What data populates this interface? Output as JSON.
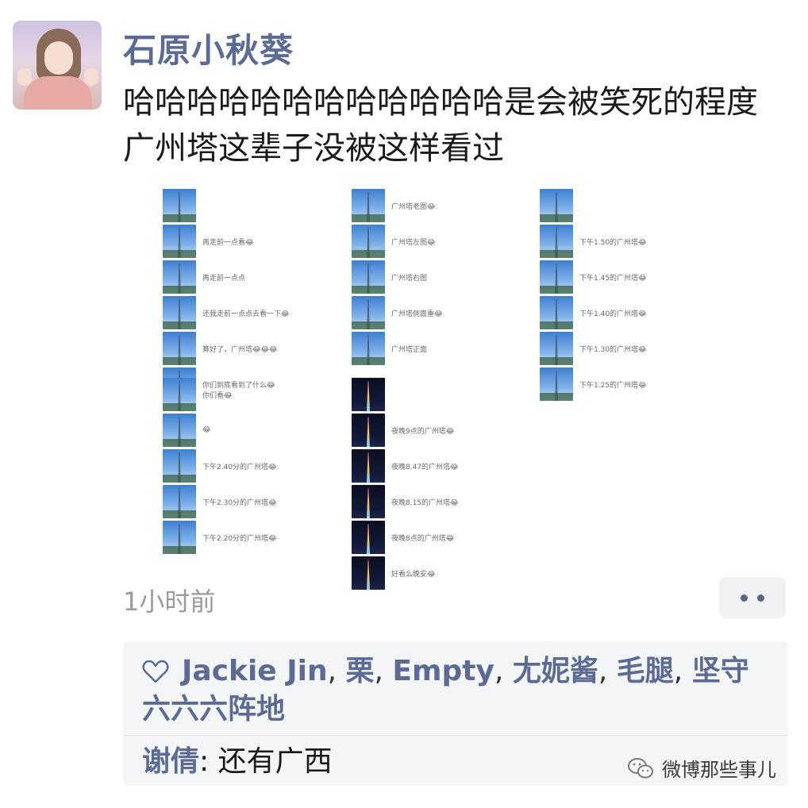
{
  "post": {
    "author": "石原小秋葵",
    "text": "哈哈哈哈哈哈哈哈哈哈哈哈是会被笑死的程度 广州塔这辈子没被这样看过",
    "time": "1小时前"
  },
  "thumbnail_groups": [
    {
      "group": "col1-top",
      "items": [
        {
          "caption": "",
          "theme": "day"
        },
        {
          "caption": "再走前一点看😂",
          "theme": "day"
        },
        {
          "caption": "再走前一点点",
          "theme": "day"
        },
        {
          "caption": "还我走前一点点去看一下😂",
          "theme": "day"
        },
        {
          "caption": "算好了，广州塔😂😂😂",
          "theme": "day"
        },
        {
          "caption": "你们到底看到了什么😂",
          "theme": "day"
        }
      ]
    },
    {
      "group": "col2-top",
      "items": [
        {
          "caption": "广州塔老图😂",
          "theme": "day"
        },
        {
          "caption": "广州塔左图😂",
          "theme": "day"
        },
        {
          "caption": "广州塔右图",
          "theme": "day"
        },
        {
          "caption": "广州塔侧面重😂",
          "theme": "day"
        },
        {
          "caption": "广州塔正面",
          "theme": "day"
        }
      ]
    },
    {
      "group": "col3-top",
      "items": [
        {
          "caption": "",
          "theme": "day"
        },
        {
          "caption": "下午1.50的广州塔😂",
          "theme": "day"
        },
        {
          "caption": "下午1.45的广州塔😂",
          "theme": "day"
        },
        {
          "caption": "下午1.40的广州塔😂",
          "theme": "day"
        },
        {
          "caption": "下午1.30的广州塔😂",
          "theme": "day"
        },
        {
          "caption": "下午1.25的广州塔😂",
          "theme": "day"
        }
      ]
    },
    {
      "group": "col1-bottom",
      "items": [
        {
          "caption": "你们看😂",
          "theme": "day"
        },
        {
          "caption": "😂",
          "theme": "day"
        },
        {
          "caption": "下午2.40分的广州塔😂",
          "theme": "day"
        },
        {
          "caption": "下午2.30分的广州塔😂",
          "theme": "day"
        },
        {
          "caption": "下午2.20分的广州塔😂",
          "theme": "day"
        }
      ]
    },
    {
      "group": "col2-bottom",
      "items": [
        {
          "caption": "",
          "theme": "night"
        },
        {
          "caption": "夜晚9点的广州塔😂",
          "theme": "night"
        },
        {
          "caption": "夜晚8.47的广州塔😂",
          "theme": "night"
        },
        {
          "caption": "夜晚8.15的广州塔😂",
          "theme": "night"
        },
        {
          "caption": "夜晚8点的广州塔😂",
          "theme": "night"
        },
        {
          "caption": "好看么晚安😂",
          "theme": "night"
        }
      ]
    }
  ],
  "likes": {
    "names": [
      "Jackie Jin",
      "栗",
      "Empty",
      "尢妮酱",
      "毛腿",
      "坚守六六六阵地"
    ],
    "separator": ", "
  },
  "comment": {
    "author": "谢倩",
    "colon": ": ",
    "text": "还有广西"
  },
  "watermark": {
    "text": "微博那些事儿"
  },
  "icons": {
    "like": "heart-outline-icon",
    "more": "more-dots-icon",
    "watermark": "wechat-icon"
  },
  "colors": {
    "name_blue": "#5b6b94",
    "time_gray": "#9b9b9b",
    "likes_bg": "#f4f5f7"
  }
}
